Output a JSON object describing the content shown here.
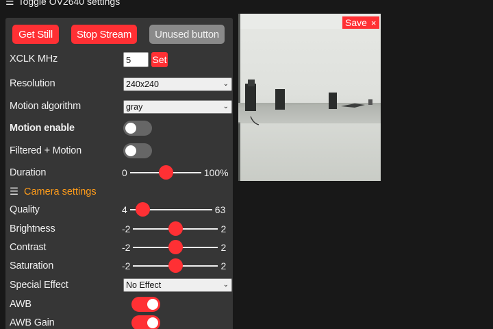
{
  "header": {
    "title": "Toggle OV2640 settings"
  },
  "buttons": {
    "get_still": "Get Still",
    "stop_stream": "Stop Stream",
    "unused": "Unused button"
  },
  "xclk": {
    "label": "XCLK MHz",
    "value": "5",
    "set": "Set"
  },
  "resolution": {
    "label": "Resolution",
    "value": "240x240"
  },
  "motion_algorithm": {
    "label": "Motion algorithm",
    "value": "gray"
  },
  "motion_enable": {
    "label": "Motion enable",
    "on": false
  },
  "filtered_motion": {
    "label": "Filtered + Motion",
    "on": false
  },
  "duration": {
    "label": "Duration",
    "min": "0",
    "max": "100%",
    "level": 0.5
  },
  "camera_settings": {
    "label": "Camera settings"
  },
  "quality": {
    "label": "Quality",
    "min": "4",
    "max": "63",
    "level": 0.15
  },
  "brightness": {
    "label": "Brightness",
    "min": "-2",
    "max": "2",
    "level": 0.5
  },
  "contrast": {
    "label": "Contrast",
    "min": "-2",
    "max": "2",
    "level": 0.5
  },
  "saturation": {
    "label": "Saturation",
    "min": "-2",
    "max": "2",
    "level": 0.5
  },
  "special_effect": {
    "label": "Special Effect",
    "value": "No Effect"
  },
  "awb": {
    "label": "AWB",
    "on": true
  },
  "awb_gain": {
    "label": "AWB Gain",
    "on": true
  },
  "preview": {
    "save_label": "Save",
    "close_glyph": "×"
  },
  "colors": {
    "accent": "#ff3034",
    "section": "#ff9c1a",
    "panel": "#363636",
    "background": "#181818"
  }
}
